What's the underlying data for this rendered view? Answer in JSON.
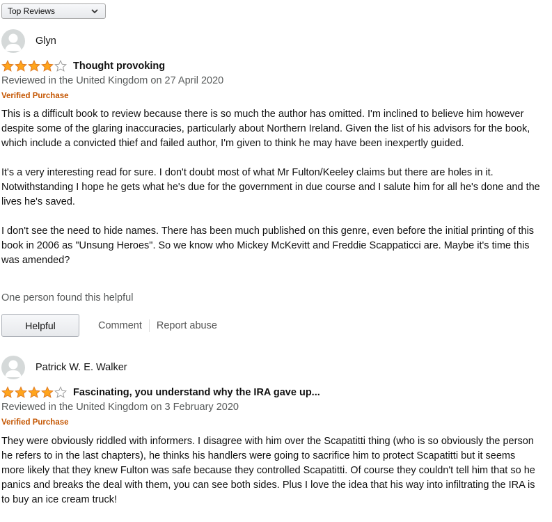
{
  "sort": {
    "selected": "Top Reviews"
  },
  "reviews": [
    {
      "name": "Glyn",
      "rating": 4,
      "title": "Thought provoking",
      "meta": "Reviewed in the United Kingdom on 27 April 2020",
      "verified": "Verified Purchase",
      "paragraphs": [
        "This is a difficult book to review because there is so much the author has omitted. I'm inclined to believe him however despite some of the glaring inaccuracies, particularly about Northern Ireland. Given the list of his advisors for the book, which include a convicted thief and failed author, I'm given to think he may have been inexpertly guided.",
        "It's a very interesting read for sure. I don't doubt most of what Mr Fulton/Keeley claims but there are holes in it. Notwithstanding I hope he gets what he's due for the government in due course and I salute him for all he's done and the lives he's saved.",
        "I don't see the need to hide names. There has been much published on this genre, even before the initial printing of this book in 2006 as \"Unsung Heroes\". So we know who Mickey McKevitt and Freddie Scappaticci are. Maybe it's time this was amended?"
      ],
      "helpful_count": "One person found this helpful",
      "helpful_label": "Helpful",
      "comment_label": "Comment",
      "report_label": "Report abuse"
    },
    {
      "name": "Patrick W. E. Walker",
      "rating": 4,
      "title": "Fascinating, you understand why the IRA gave up...",
      "meta": "Reviewed in the United Kingdom on 3 February 2020",
      "verified": "Verified Purchase",
      "paragraphs": [
        "They were obviously riddled with informers. I disagree with him over the Scapatitti thing (who is so obviously the person he refers to in the last chapters), he thinks his handlers were going to sacrifice him to protect Scapatitti but it seems more likely that they knew Fulton was safe because they controlled Scapatitti. Of course they couldn't tell him that so he panics and breaks the deal with them, you can see both sides. Plus I love the idea that his way into infiltrating the IRA is to buy an ice cream truck!"
      ]
    }
  ],
  "colors": {
    "star": "#ffa41c",
    "verified": "#c45500",
    "meta": "#565959"
  }
}
